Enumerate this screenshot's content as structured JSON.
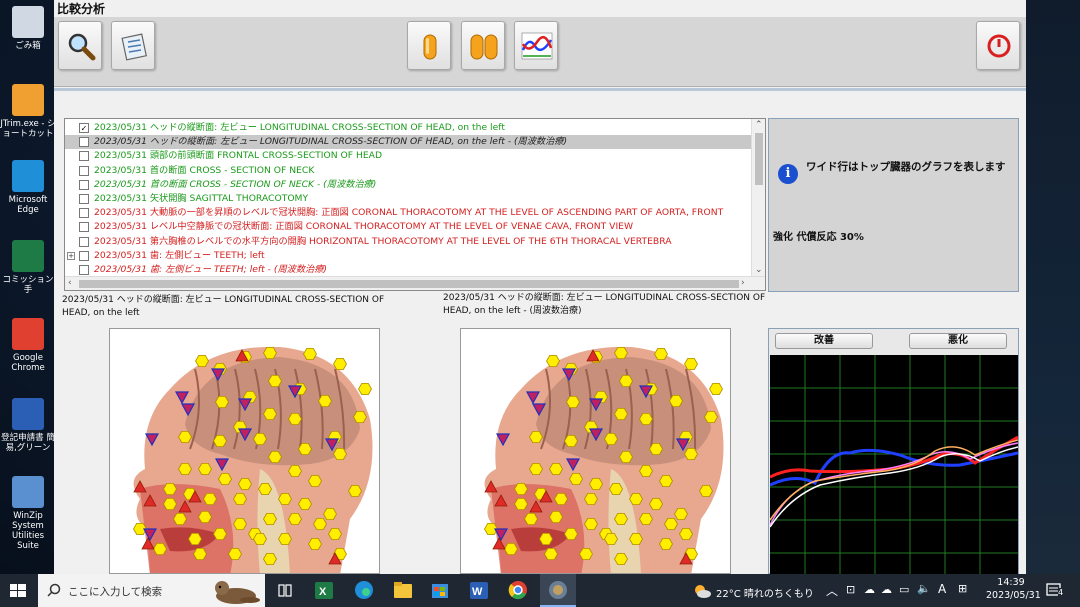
{
  "window": {
    "title": "比較分析"
  },
  "desktop_icons": [
    {
      "label": "ごみ箱",
      "color": "#cfd8e3"
    },
    {
      "label": "JTrim.exe - ショートカット",
      "color": "#f0a030"
    },
    {
      "label": "Microsoft Edge",
      "color": "#1f8fd8"
    },
    {
      "label": "コミッション手",
      "color": "#1e7b45"
    },
    {
      "label": "Google Chrome",
      "color": "#e04030"
    },
    {
      "label": "登記申請書 簡易,グリーン",
      "color": "#2b5fb5"
    },
    {
      "label": "WinZip System Utilities Suite",
      "color": "#5a8fd0"
    }
  ],
  "toolbar": {
    "buttons": [
      "search-icon",
      "notes-icon",
      "single-capsule-icon",
      "double-capsule-icon",
      "wave-graph-icon",
      "power-icon"
    ]
  },
  "report_list": {
    "rows": [
      {
        "date": "2023/05/31",
        "text": "ヘッドの縦断面: 左ビュー  LONGITUDINAL CROSS-SECTION OF HEAD, on the left",
        "color": "#1a9a1a",
        "italic": false,
        "checked": true,
        "selected": false,
        "expand": false
      },
      {
        "date": "2023/05/31",
        "text": "ヘッドの縦断面: 左ビュー  LONGITUDINAL CROSS-SECTION OF HEAD, on the left - (周波数治療)",
        "color": "#222222",
        "italic": true,
        "checked": false,
        "selected": true,
        "expand": false
      },
      {
        "date": "2023/05/31",
        "text": "頭部の前頭断面  FRONTAL CROSS-SECTION OF HEAD",
        "color": "#1a9a1a",
        "italic": false,
        "checked": false,
        "selected": false,
        "expand": false
      },
      {
        "date": "2023/05/31",
        "text": "首の断面  CROSS - SECTION OF NECK",
        "color": "#1a9a1a",
        "italic": false,
        "checked": false,
        "selected": false,
        "expand": false
      },
      {
        "date": "2023/05/31",
        "text": "首の断面  CROSS - SECTION OF NECK - (周波数治療)",
        "color": "#1a9a1a",
        "italic": true,
        "checked": false,
        "selected": false,
        "expand": false
      },
      {
        "date": "2023/05/31",
        "text": "矢状開胸  SAGITTAL THORACOTOMY",
        "color": "#1a9a1a",
        "italic": false,
        "checked": false,
        "selected": false,
        "expand": false
      },
      {
        "date": "2023/05/31",
        "text": "大動脈の一部を昇順のレベルで冠状開胸: 正面図 CORONAL THORACOTOMY AT THE LEVEL OF ASCENDING PART OF AORTA, FRONT",
        "color": "#d42020",
        "italic": false,
        "checked": false,
        "selected": false,
        "expand": false
      },
      {
        "date": "2023/05/31",
        "text": "レベル中空静脈での冠状断面: 正面図 CORONAL THORACOTOMY AT THE LEVEL OF VENAE CAVA, FRONT VIEW",
        "color": "#d42020",
        "italic": false,
        "checked": false,
        "selected": false,
        "expand": false
      },
      {
        "date": "2023/05/31",
        "text": "第六胸椎のレベルでの水平方向の開胸 HORIZONTAL THORACOTOMY AT THE LEVEL OF THE 6TH THORACAL VERTEBRA",
        "color": "#d42020",
        "italic": false,
        "checked": false,
        "selected": false,
        "expand": false
      },
      {
        "date": "2023/05/31",
        "text": "歯: 左側ビュー TEETH; left",
        "color": "#d42020",
        "italic": false,
        "checked": false,
        "selected": false,
        "expand": true
      },
      {
        "date": "2023/05/31",
        "text": "歯: 左側ビュー TEETH; left - (周波数治療)",
        "color": "#d42020",
        "italic": true,
        "checked": false,
        "selected": false,
        "expand": false
      }
    ]
  },
  "info_panel": {
    "message": "ワイド行はトップ臓器のグラフを表します",
    "value": "強化 代償反応 30%"
  },
  "captions": {
    "left": "2023/05/31 ヘッドの縦断面: 左ビュー  LONGITUDINAL CROSS-SECTION OF HEAD, on the left",
    "right": "2023/05/31 ヘッドの縦断面: 左ビュー  LONGITUDINAL CROSS-SECTION OF HEAD, on the left - (周波数治療)"
  },
  "graph_panel": {
    "improve_label": "改善",
    "worsen_label": "悪化",
    "grid_color": "#1f7a1f",
    "series_colors": [
      "#2040ff",
      "#ff2020",
      "#ff80ff",
      "#ffb060",
      "#ffffff"
    ]
  },
  "taskbar": {
    "search_placeholder": "ここに入力して検索",
    "weather": "22°C  晴れのちくもり",
    "time": "14:39",
    "date": "2023/05/31",
    "notification_count": "4"
  }
}
